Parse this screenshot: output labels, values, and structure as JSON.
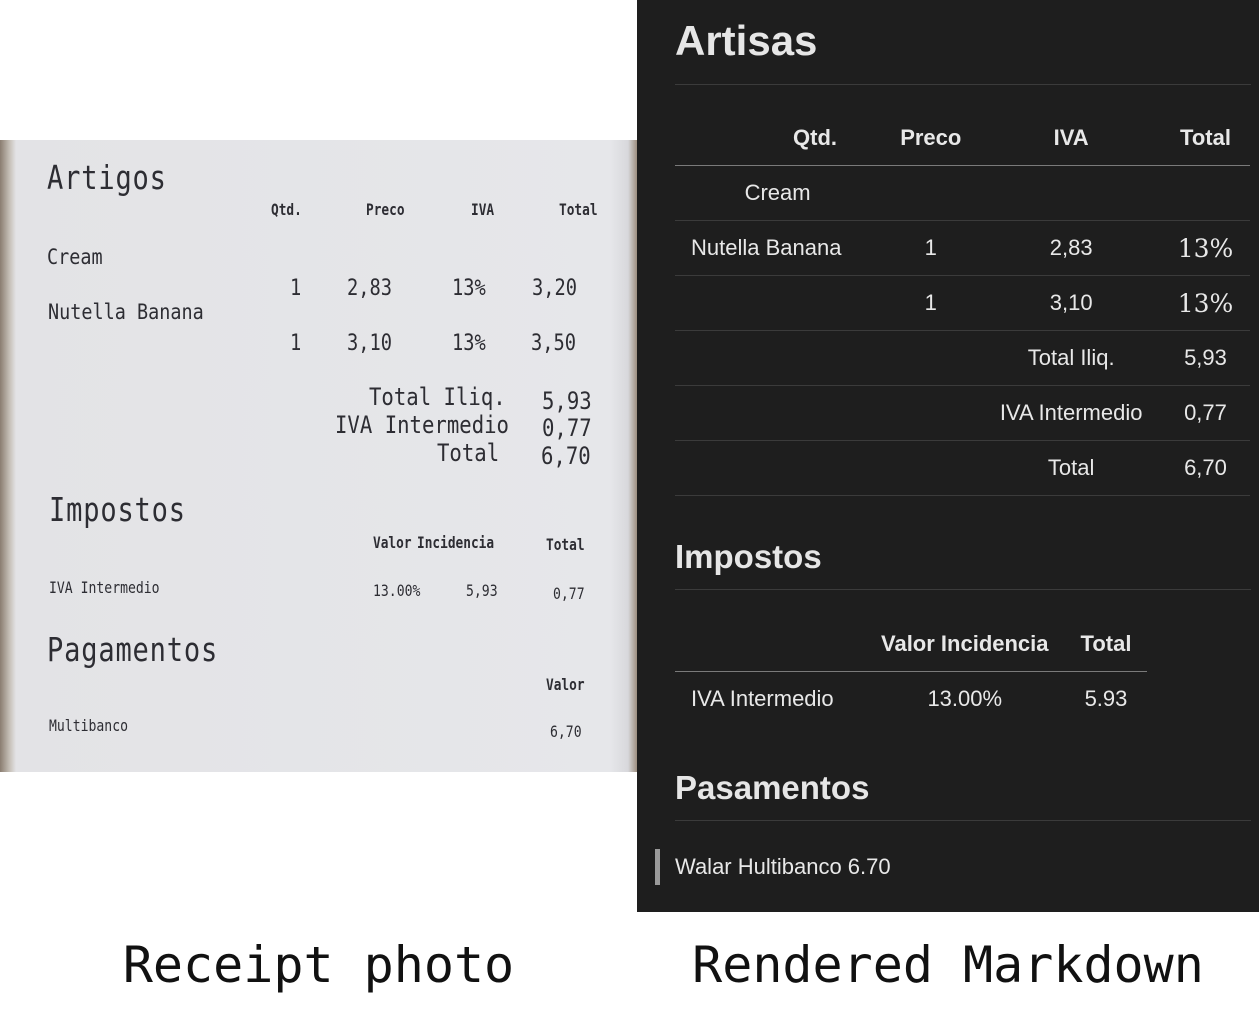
{
  "photo": {
    "heading_items": "Artigos",
    "col_qty": "Qtd.",
    "col_price": "Preco",
    "col_vat": "IVA",
    "col_total": "Total",
    "item1": "Cream",
    "item2": "Nutella Banana",
    "rows": [
      {
        "qty": "1",
        "price": "2,83",
        "vat": "13%",
        "total": "3,20"
      },
      {
        "qty": "1",
        "price": "3,10",
        "vat": "13%",
        "total": "3,50"
      }
    ],
    "sum_net_label": "Total Iliq.",
    "sum_net": "5,93",
    "sum_vat_label": "IVA Intermedio",
    "sum_vat": "0,77",
    "sum_total_label": "Total",
    "sum_total": "6,70",
    "heading_taxes": "Impostos",
    "tax_col_rate": "Valor",
    "tax_col_base": "Incidencia",
    "tax_col_total": "Total",
    "tax_name": "IVA Intermedio",
    "tax_rate": "13.00%",
    "tax_base": "5,93",
    "tax_total": "0,77",
    "heading_payments": "Pagamentos",
    "pay_col": "Valor",
    "pay_method": "Multibanco",
    "pay_value": "6,70"
  },
  "markdown": {
    "h1": "Artisas",
    "table1": {
      "headers": [
        "",
        "Qtd.",
        "Preco",
        "IVA",
        "Total"
      ],
      "rows": [
        [
          "",
          "Cream",
          "",
          "",
          ""
        ],
        [
          "Nutella Banana",
          "1",
          "2,83",
          "13%",
          ""
        ],
        [
          "",
          "1",
          "3,10",
          "13%",
          ""
        ],
        [
          "",
          "",
          "Total Iliq.",
          "5,93",
          ""
        ],
        [
          "",
          "",
          "IVA Intermedio",
          "0,77",
          ""
        ],
        [
          "",
          "",
          "Total",
          "6,70",
          ""
        ]
      ]
    },
    "h2_taxes": "Impostos",
    "table2": {
      "headers": [
        "",
        "Valor Incidencia",
        "Total"
      ],
      "rows": [
        [
          "IVA Intermedio",
          "13.00%",
          "5.93"
        ]
      ]
    },
    "h2_payments": "Pasamentos",
    "quote": "Walar Hultibanco 6.70"
  },
  "captions": {
    "left": "Receipt photo",
    "right": "Rendered Markdown"
  }
}
